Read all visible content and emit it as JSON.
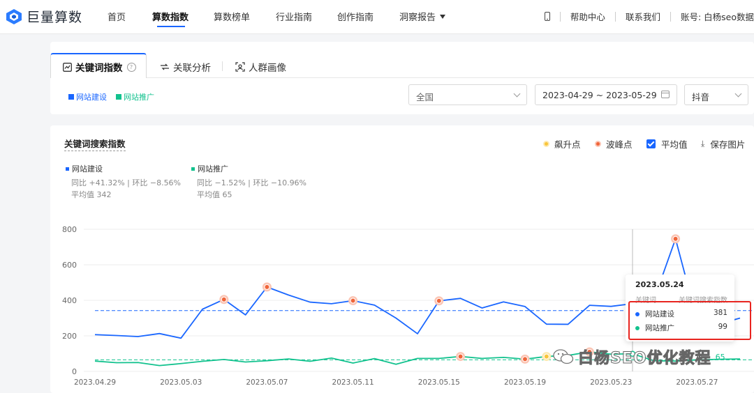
{
  "nav": {
    "logo_text": "巨量算数",
    "menu": [
      "首页",
      "算数指数",
      "算数榜单",
      "行业指南",
      "创作指南",
      "洞察报告"
    ],
    "active_menu": "算数指数",
    "help": "帮助中心",
    "contact": "联系我们",
    "account": "账号: 白杨seo数据"
  },
  "tabs": {
    "keyword_index": "关键词指数",
    "correlation": "关联分析",
    "crowd_profile": "人群画像"
  },
  "filters": {
    "keywords": [
      {
        "label": "网站建设",
        "color": "#1966ff"
      },
      {
        "label": "网站推广",
        "color": "#12c28e"
      }
    ],
    "region": "全国",
    "date_range": "2023-04-29 ~ 2023-05-29",
    "platform": "抖音"
  },
  "chart_header": {
    "title": "关键词搜索指数",
    "rise_point": "飙升点",
    "peak_point": "波峰点",
    "average": "平均值",
    "save_image": "保存图片"
  },
  "series_stats": [
    {
      "name": "网站建设",
      "yoy_mom": "同比 +41.32% | 环比 −8.56%",
      "avg": "平均值 342",
      "color": "#1966ff"
    },
    {
      "name": "网站推广",
      "yoy_mom": "同比 −1.52% | 环比 −10.96%",
      "avg": "平均值 65",
      "color": "#12c28e"
    }
  ],
  "chart_data": {
    "type": "line",
    "title": "关键词搜索指数",
    "x": [
      "2023.04.29",
      "2023.04.30",
      "2023.05.01",
      "2023.05.02",
      "2023.05.03",
      "2023.05.04",
      "2023.05.05",
      "2023.05.06",
      "2023.05.07",
      "2023.05.08",
      "2023.05.09",
      "2023.05.10",
      "2023.05.11",
      "2023.05.12",
      "2023.05.13",
      "2023.05.14",
      "2023.05.15",
      "2023.05.16",
      "2023.05.17",
      "2023.05.18",
      "2023.05.19",
      "2023.05.20",
      "2023.05.21",
      "2023.05.22",
      "2023.05.23",
      "2023.05.24",
      "2023.05.25",
      "2023.05.26",
      "2023.05.27",
      "2023.05.28",
      "2023.05.29"
    ],
    "x_tick_labels": [
      "2023.04.29",
      "2023.05.03",
      "2023.05.07",
      "2023.05.11",
      "2023.05.15",
      "2023.05.19",
      "2023.05.23",
      "2023.05.27"
    ],
    "ylim": [
      0,
      800
    ],
    "y_ticks": [
      0,
      200,
      400,
      600,
      800
    ],
    "series": [
      {
        "name": "网站建设",
        "color": "#1966ff",
        "values": [
          207,
          202,
          196,
          213,
          187,
          350,
          405,
          318,
          475,
          430,
          390,
          381,
          398,
          373,
          300,
          212,
          397,
          411,
          357,
          391,
          365,
          266,
          265,
          372,
          366,
          381,
          405,
          746,
          290,
          266,
          300
        ],
        "average": 342,
        "peaks": [
          6,
          8,
          12,
          16,
          27
        ],
        "rises": []
      },
      {
        "name": "网站推广",
        "color": "#12c28e",
        "values": [
          58,
          49,
          50,
          33,
          44,
          57,
          67,
          53,
          60,
          70,
          57,
          75,
          47,
          72,
          40,
          73,
          73,
          84,
          73,
          79,
          69,
          84,
          90,
          110,
          97,
          99,
          60,
          58,
          65,
          68,
          70
        ],
        "average": 65,
        "peaks": [
          17,
          20,
          23
        ],
        "rises": [
          21
        ]
      }
    ],
    "grid": true,
    "legend": "top-left"
  },
  "tooltip": {
    "date": "2023.05.24",
    "col_keyword": "关键词",
    "col_index": "关键词搜索指数",
    "rows": [
      {
        "name": "网站建设",
        "value": "381",
        "color": "#1966ff"
      },
      {
        "name": "网站推广",
        "value": "99",
        "color": "#12c28e"
      }
    ]
  },
  "watermark": {
    "text": "白杨SEO优化教程",
    "partial_label": "65"
  }
}
